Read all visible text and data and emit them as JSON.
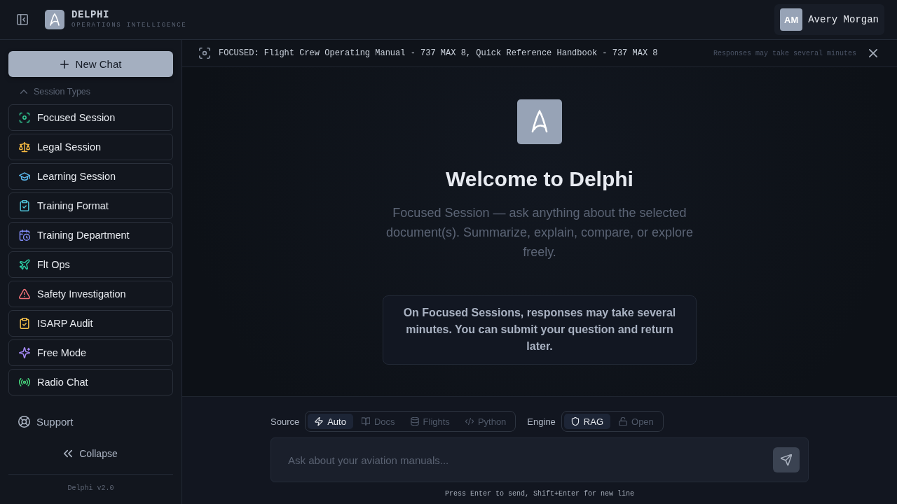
{
  "header": {
    "brand": {
      "name": "DELPHI",
      "tagline": "OPERATIONS INTELLIGENCE"
    },
    "user": {
      "initials": "AM",
      "name": "Avery Morgan"
    }
  },
  "sidebar": {
    "new_chat": "New Chat",
    "section": {
      "label": "Session Types",
      "expanded": true
    },
    "items": [
      {
        "label": "Focused Session",
        "color": "#34d399"
      },
      {
        "label": "Legal Session",
        "color": "#f5b942"
      },
      {
        "label": "Learning Session",
        "color": "#5ab4e8"
      },
      {
        "label": "Training Format",
        "color": "#4fc3d9"
      },
      {
        "label": "Training Department",
        "color": "#818cf8"
      },
      {
        "label": "Flt Ops",
        "color": "#2dd4aa"
      },
      {
        "label": "Safety Investigation",
        "color": "#f07178"
      },
      {
        "label": "ISARP Audit",
        "color": "#f5c04a"
      },
      {
        "label": "Free Mode",
        "color": "#a78bfa"
      },
      {
        "label": "Radio Chat",
        "color": "#4ade80"
      }
    ],
    "support": "Support",
    "collapse": "Collapse",
    "version": "Delphi v2.0"
  },
  "banner": {
    "text": "FOCUSED: Flight Crew Operating Manual - 737 MAX 8, Quick Reference Handbook - 737 MAX 8",
    "note": "Responses may take several minutes"
  },
  "welcome": {
    "title": "Welcome to Delphi",
    "subtitle": "Focused Session — ask anything about the selected document(s). Summarize, explain, compare, or explore freely.",
    "notice": "On Focused Sessions, responses may take several minutes. You can submit your question and return later."
  },
  "composer": {
    "source": {
      "label": "Source",
      "options": [
        {
          "label": "Auto",
          "selected": true
        },
        {
          "label": "Docs",
          "selected": false
        },
        {
          "label": "Flights",
          "selected": false
        },
        {
          "label": "Python",
          "selected": false
        }
      ]
    },
    "engine": {
      "label": "Engine",
      "options": [
        {
          "label": "RAG",
          "selected": true
        },
        {
          "label": "Open",
          "selected": false
        }
      ]
    },
    "input": {
      "placeholder": "Ask about your aviation manuals..."
    },
    "hint": "Press Enter to send, Shift+Enter for new line"
  }
}
